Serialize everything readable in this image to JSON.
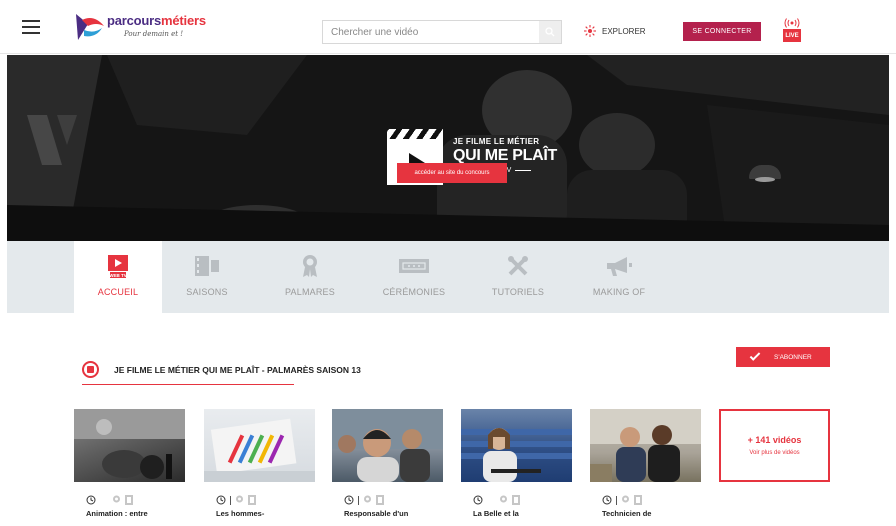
{
  "header": {
    "logo_main": "parcours",
    "logo_accent": "métiers",
    "logo_tagline": "Pour demain et !",
    "search_placeholder": "Chercher une vidéo",
    "explorer_label": "EXPLORER",
    "connect_label": "SE CONNECTER",
    "live_label": "LIVE"
  },
  "hero": {
    "line1": "JE FILME LE MÉTIER",
    "line2": "QUI ME PLAÎT",
    "line3": "WEB TV",
    "button_label": "accéder au site du concours"
  },
  "tabs": [
    {
      "label": "ACCUEIL",
      "icon": "web-tv-icon",
      "active": true
    },
    {
      "label": "SAISONS",
      "icon": "film-icon",
      "active": false
    },
    {
      "label": "PALMARES",
      "icon": "award-icon",
      "active": false
    },
    {
      "label": "CÉRÉMONIES",
      "icon": "ticket-icon",
      "active": false
    },
    {
      "label": "TUTORIELS",
      "icon": "tools-icon",
      "active": false
    },
    {
      "label": "MAKING OF",
      "icon": "megaphone-icon",
      "active": false
    }
  ],
  "section": {
    "title": "JE FILME LE MÉTIER QUI ME PLAÎT - PALMARÈS SAISON 13",
    "subscribe_label": "S'ABONNER"
  },
  "videos": [
    {
      "title": "Animation : entre"
    },
    {
      "title": "Les hommes-"
    },
    {
      "title": "Responsable d'un"
    },
    {
      "title": "La Belle et la"
    },
    {
      "title": "Technicien de"
    }
  ],
  "more": {
    "count": "+ 141 vidéos",
    "link": "Voir plus de vidéos"
  },
  "colors": {
    "accent": "#e6343f",
    "brand_purple": "#4b2d83",
    "connect": "#b4214d",
    "tab_bar": "#e4e9ec"
  }
}
